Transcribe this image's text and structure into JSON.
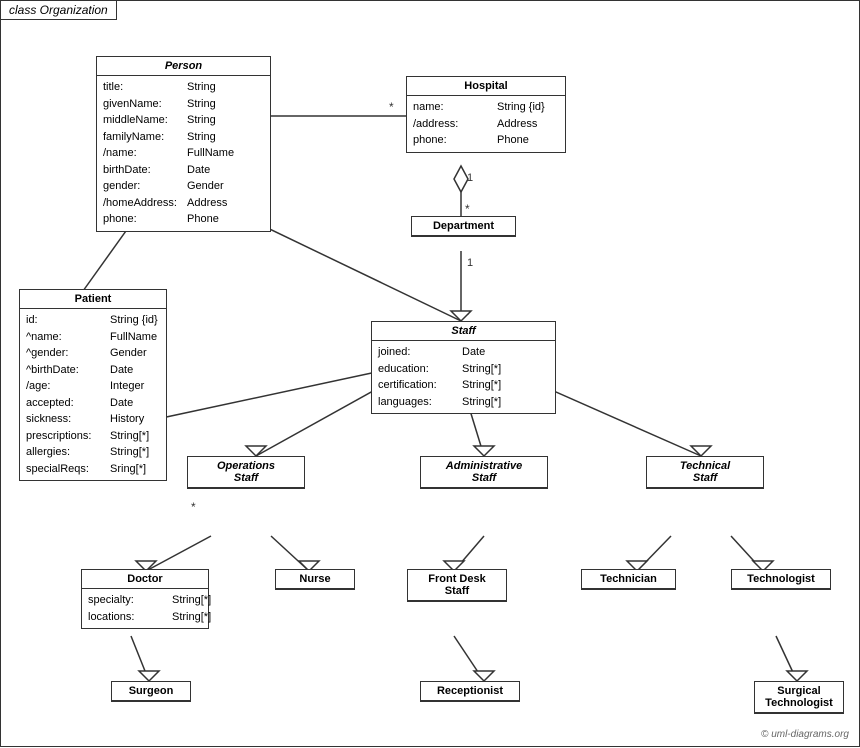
{
  "title": "class Organization",
  "copyright": "© uml-diagrams.org",
  "boxes": {
    "person": {
      "title": "Person",
      "italic": true,
      "attrs": [
        {
          "name": "title:",
          "type": "String"
        },
        {
          "name": "givenName:",
          "type": "String"
        },
        {
          "name": "middleName:",
          "type": "String"
        },
        {
          "name": "familyName:",
          "type": "String"
        },
        {
          "name": "/name:",
          "type": "FullName"
        },
        {
          "name": "birthDate:",
          "type": "Date"
        },
        {
          "name": "gender:",
          "type": "Gender"
        },
        {
          "name": "/homeAddress:",
          "type": "Address"
        },
        {
          "name": "phone:",
          "type": "Phone"
        }
      ]
    },
    "hospital": {
      "title": "Hospital",
      "italic": false,
      "attrs": [
        {
          "name": "name:",
          "type": "String {id}"
        },
        {
          "name": "/address:",
          "type": "Address"
        },
        {
          "name": "phone:",
          "type": "Phone"
        }
      ]
    },
    "department": {
      "title": "Department",
      "italic": false,
      "attrs": []
    },
    "staff": {
      "title": "Staff",
      "italic": true,
      "attrs": [
        {
          "name": "joined:",
          "type": "Date"
        },
        {
          "name": "education:",
          "type": "String[*]"
        },
        {
          "name": "certification:",
          "type": "String[*]"
        },
        {
          "name": "languages:",
          "type": "String[*]"
        }
      ]
    },
    "patient": {
      "title": "Patient",
      "italic": false,
      "attrs": [
        {
          "name": "id:",
          "type": "String {id}"
        },
        {
          "name": "^name:",
          "type": "FullName"
        },
        {
          "name": "^gender:",
          "type": "Gender"
        },
        {
          "name": "^birthDate:",
          "type": "Date"
        },
        {
          "name": "/age:",
          "type": "Integer"
        },
        {
          "name": "accepted:",
          "type": "Date"
        },
        {
          "name": "sickness:",
          "type": "History"
        },
        {
          "name": "prescriptions:",
          "type": "String[*]"
        },
        {
          "name": "allergies:",
          "type": "String[*]"
        },
        {
          "name": "specialReqs:",
          "type": "Sring[*]"
        }
      ]
    },
    "operations_staff": {
      "title": "Operations Staff",
      "italic": true,
      "attrs": []
    },
    "administrative_staff": {
      "title": "Administrative Staff",
      "italic": true,
      "attrs": []
    },
    "technical_staff": {
      "title": "Technical Staff",
      "italic": true,
      "attrs": []
    },
    "doctor": {
      "title": "Doctor",
      "italic": false,
      "attrs": [
        {
          "name": "specialty:",
          "type": "String[*]"
        },
        {
          "name": "locations:",
          "type": "String[*]"
        }
      ]
    },
    "nurse": {
      "title": "Nurse",
      "italic": false,
      "attrs": []
    },
    "front_desk_staff": {
      "title": "Front Desk Staff",
      "italic": false,
      "attrs": []
    },
    "technician": {
      "title": "Technician",
      "italic": false,
      "attrs": []
    },
    "technologist": {
      "title": "Technologist",
      "italic": false,
      "attrs": []
    },
    "surgeon": {
      "title": "Surgeon",
      "italic": false,
      "attrs": []
    },
    "receptionist": {
      "title": "Receptionist",
      "italic": false,
      "attrs": []
    },
    "surgical_technologist": {
      "title": "Surgical Technologist",
      "italic": false,
      "attrs": []
    }
  }
}
